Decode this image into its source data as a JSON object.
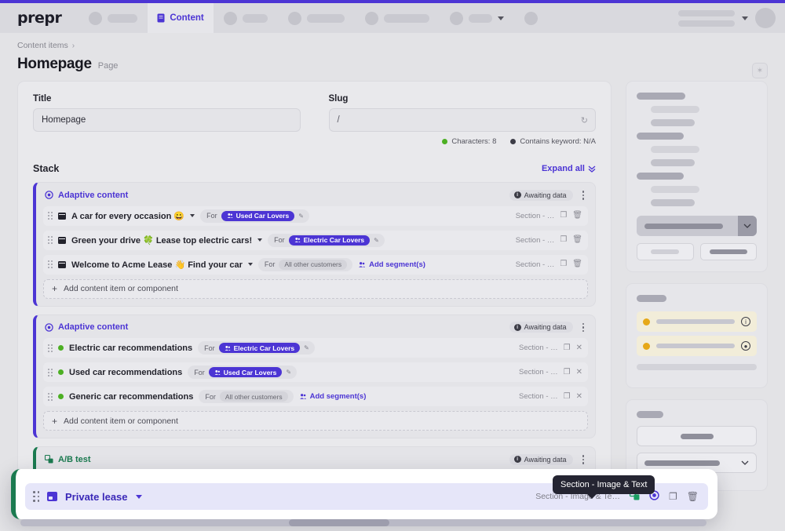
{
  "navbar": {
    "logo": "prepr",
    "active_tab": {
      "label": "Content",
      "icon": "document-icon"
    },
    "chevron_icon": "chevron-down-icon",
    "avatar_icon": "avatar"
  },
  "breadcrumb": {
    "parent": "Content items",
    "separator": "›"
  },
  "header": {
    "title": "Homepage",
    "type": "Page",
    "action_icon": "sparkle-icon"
  },
  "fields": {
    "title": {
      "label": "Title",
      "value": "Homepage",
      "placeholder": "Title"
    },
    "slug": {
      "label": "Slug",
      "value": "/",
      "placeholder": "/",
      "refresh_icon": "refresh-icon"
    },
    "meta": [
      {
        "label": "Characters: 8",
        "color": "#4caf23",
        "dot": "status-dot"
      },
      {
        "label": "Contains keyword: N/A",
        "color": "#3c3c46",
        "dot": "status-dot"
      }
    ]
  },
  "stack": {
    "title": "Stack",
    "expand_all": "Expand all",
    "expand_icon": "double-chevron-down-icon",
    "add_row_label": "Add content item or component",
    "awaiting_label": "Awaiting data",
    "blocks": [
      {
        "kind": "Adaptive content",
        "accent": "#4c35d4",
        "kind_icon": "target-icon",
        "rows": [
          {
            "name": "A car for every occasion 😀",
            "icon": "section-icon",
            "has_chevron": true,
            "for_label": "For",
            "segment": "Used Car Lovers",
            "segment_type": "badge",
            "edit_icon": "pencil-icon",
            "section": "Section - …",
            "icons": [
              "copy-icon",
              "trash-icon"
            ]
          },
          {
            "name": "Green your drive 🍀 Lease top electric cars!",
            "icon": "section-icon",
            "has_chevron": true,
            "for_label": "For",
            "segment": "Electric Car Lovers",
            "segment_type": "badge",
            "edit_icon": "pencil-icon",
            "section": "Section - …",
            "icons": [
              "copy-icon",
              "trash-icon"
            ]
          },
          {
            "name": "Welcome to Acme Lease 👋 Find your car",
            "icon": "section-icon",
            "has_chevron": true,
            "for_label": "For",
            "segment": "All other customers",
            "segment_type": "plain",
            "add_segment": "Add segment(s)",
            "add_segment_icon": "people-icon",
            "section": "Section - …",
            "icons": [
              "copy-icon",
              "trash-icon"
            ]
          }
        ]
      },
      {
        "kind": "Adaptive content",
        "accent": "#4c35d4",
        "kind_icon": "target-icon",
        "rows": [
          {
            "name": "Electric car recommendations",
            "icon": "green-status-dot",
            "has_chevron": false,
            "for_label": "For",
            "segment": "Electric Car Lovers",
            "segment_type": "badge",
            "edit_icon": "pencil-icon",
            "section": "Section - …",
            "icons": [
              "copy-icon",
              "close-icon"
            ]
          },
          {
            "name": "Used car recommendations",
            "icon": "green-status-dot",
            "has_chevron": false,
            "for_label": "For",
            "segment": "Used Car Lovers",
            "segment_type": "badge",
            "edit_icon": "pencil-icon",
            "section": "Section - …",
            "icons": [
              "copy-icon",
              "close-icon"
            ]
          },
          {
            "name": "Generic car recommendations",
            "icon": "green-status-dot",
            "has_chevron": false,
            "for_label": "For",
            "segment": "All other customers",
            "segment_type": "plain",
            "add_segment": "Add segment(s)",
            "add_segment_icon": "people-icon",
            "section": "Section - …",
            "icons": [
              "copy-icon",
              "close-icon"
            ]
          }
        ]
      },
      {
        "kind": "A/B test",
        "accent": "#1b7a50",
        "kind_icon": "ab-test-icon",
        "rows": []
      }
    ]
  },
  "drag_overlay": {
    "name": "Private lease",
    "icon": "image-icon",
    "chevron_icon": "chevron-down-icon",
    "section": "Section - Image & Te…",
    "icons": [
      "ab-test-icon",
      "adaptive-content-icon",
      "copy-icon",
      "trash-icon"
    ],
    "tooltip": "Section - Image & Text"
  },
  "colors": {
    "brand_purple": "#4c35d4",
    "green": "#1b7a50",
    "status_green": "#4caf23",
    "warning_amber": "#e6a817",
    "page_bg": "#e3e3e6",
    "tooltip_bg": "#252532"
  }
}
